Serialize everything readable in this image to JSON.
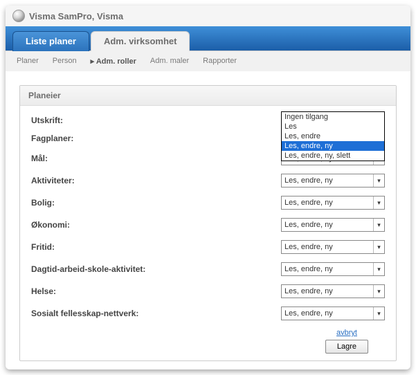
{
  "app": {
    "title": "Visma SamPro, Visma"
  },
  "tabs": {
    "t0": "Liste planer",
    "t1": "Adm. virksomhet"
  },
  "subnav": {
    "i0": "Planer",
    "i1": "Person",
    "i2": "Adm. roller",
    "i3": "Adm. maler",
    "i4": "Rapporter"
  },
  "panel": {
    "title": "Planeier"
  },
  "dropdown": {
    "o0": "Ingen tilgang",
    "o1": "Les",
    "o2": "Les, endre",
    "o3": "Les, endre, ny",
    "o4": "Les, endre, ny, slett"
  },
  "rows": {
    "r0": {
      "label": "Utskrift:"
    },
    "r1": {
      "label": "Fagplaner:"
    },
    "r2": {
      "label": "Mål:",
      "value": "Les, endre, ny"
    },
    "r3": {
      "label": "Aktiviteter:",
      "value": "Les, endre, ny"
    },
    "r4": {
      "label": "Bolig:",
      "value": "Les, endre, ny"
    },
    "r5": {
      "label": "Økonomi:",
      "value": "Les, endre, ny"
    },
    "r6": {
      "label": "Fritid:",
      "value": "Les, endre, ny"
    },
    "r7": {
      "label": "Dagtid-arbeid-skole-aktivitet:",
      "value": "Les, endre, ny"
    },
    "r8": {
      "label": "Helse:",
      "value": "Les, endre, ny"
    },
    "r9": {
      "label": "Sosialt fellesskap-nettverk:",
      "value": "Les, endre, ny"
    }
  },
  "actions": {
    "cancel": "avbryt",
    "save": "Lagre"
  }
}
